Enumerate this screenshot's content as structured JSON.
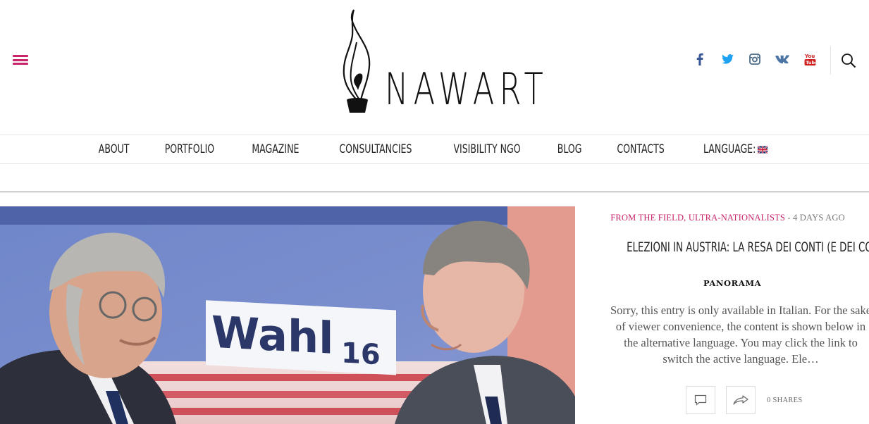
{
  "header": {
    "logo_text": "NAWART",
    "menu_icon": "hamburger-menu-icon",
    "social_icons": [
      "facebook-icon",
      "twitter-icon",
      "instagram-icon",
      "vk-icon",
      "youtube-icon"
    ],
    "search_icon": "search-icon"
  },
  "nav": {
    "items": [
      "ABOUT",
      "PORTFOLIO",
      "MAGAZINE",
      "CONSULTANCIES",
      "VISIBILITY NGO",
      "BLOG",
      "CONTACTS",
      "LANGUAGE:"
    ],
    "language_flag": "uk-flag-icon"
  },
  "hero": {
    "image": "election-debate-photo",
    "sign_text": "Wahl",
    "sign_number": "16"
  },
  "article": {
    "categories": "FROM THE FIELD, ULTRA-NATIONALISTS",
    "time": "4 DAYS AGO",
    "time_separator": "-",
    "title": "ELEZIONI IN AUSTRIA: LA RESA DEI CONTI (E DEI CONTEGGI)",
    "source": "PANORAMA",
    "excerpt_lines": [
      "Sorry, this entry is only available in Italian. For the sake",
      "of viewer convenience, the content is shown below in",
      "the alternative language. You may click the link to",
      "switch the active language. Ele…"
    ],
    "shares": "0 SHARES"
  },
  "colors": {
    "accent": "#c8256b",
    "facebook": "#3b5998",
    "twitter": "#1da1f2",
    "instagram": "#4a6b8a",
    "vk": "#4c75a3",
    "youtube": "#cd201f"
  }
}
